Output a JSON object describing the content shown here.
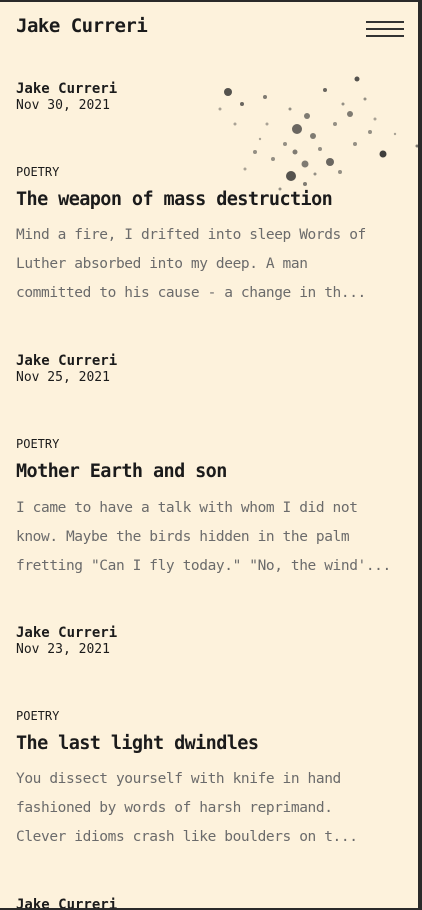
{
  "header": {
    "site_title": "Jake Curreri"
  },
  "posts": [
    {
      "author": "Jake Curreri",
      "date": "Nov 30, 2021",
      "category": "POETRY",
      "title": "The weapon of mass destruction",
      "excerpt_lines": [
        "Mind a fire, I drifted into sleep Words of",
        "Luther absorbed into my deep. A man",
        "committed to his cause - a change in th..."
      ]
    },
    {
      "author": "Jake Curreri",
      "date": "Nov 25, 2021",
      "category": "POETRY",
      "title": "Mother Earth and son",
      "excerpt_lines": [
        "I came to have a talk with whom I did not",
        "know. Maybe the birds hidden in the palm",
        "fretting \"Can I fly today.\" \"No, the wind'..."
      ]
    },
    {
      "author": "Jake Curreri",
      "date": "Nov 23, 2021",
      "category": "POETRY",
      "title": "The last light dwindles",
      "excerpt_lines": [
        "You dissect yourself with knife in hand",
        "fashioned by words of harsh reprimand.",
        "Clever idioms crash like boulders on t..."
      ]
    },
    {
      "author": "Jake Curreri"
    }
  ]
}
